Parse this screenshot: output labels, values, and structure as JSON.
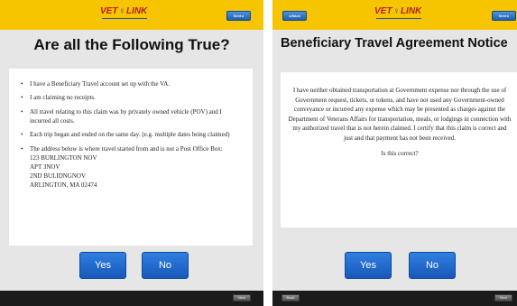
{
  "left_screen": {
    "logo": {
      "before": "VET",
      "mark": "♀",
      "after": "LINK"
    },
    "top_right_button": "Next ▸",
    "title": "Are all the Following True?",
    "bullets": [
      "I have a Beneficiary Travel account set up with the VA.",
      "I am claiming no receipts.",
      "All travel relating to this claim was by privately owned vehicle (POV) and I incurred all costs.",
      "Each trip began and ended on the same day. (e.g. multiple dates being claimed)",
      "The address below is where travel started from and is not a Post Office Box:"
    ],
    "address_lines": [
      "123 BURLINGTON NOV",
      "APT 3NOV",
      "2ND BULIDNGNOV",
      "ARLINGTON, MA 02474"
    ],
    "yes_label": "Yes",
    "no_label": "No",
    "bottom_button": "Next"
  },
  "right_screen": {
    "top_left_button": "◂ Back",
    "logo": {
      "before": "VET",
      "mark": "♀",
      "after": "LINK"
    },
    "top_right_button": "Next ▸",
    "title": "Beneficiary Travel Agreement Notice",
    "notice_text": "I have neither obtained transportation at Government expense nor through the use of Government request, tickets, or tokens, and have not used any Government-owned conveyance or incurred any expense which may be presented as charges against the Department of Veterans Affairs for transportation, meals, or lodgings in connection with my authorized travel that is not herein claimed. I certify that this claim is correct and just and that payment has not been received.",
    "question": "Is this correct?",
    "yes_label": "Yes",
    "no_label": "No",
    "bottom_left_button": "Back",
    "bottom_right_button": "Next"
  },
  "colors": {
    "header_yellow": "#f7c500",
    "button_blue": "#1f6fd0",
    "panel_gray": "#e6e6e6",
    "footer_black": "#1b1b1b",
    "logo_red": "#b42020",
    "logo_blue": "#2a59a8"
  }
}
